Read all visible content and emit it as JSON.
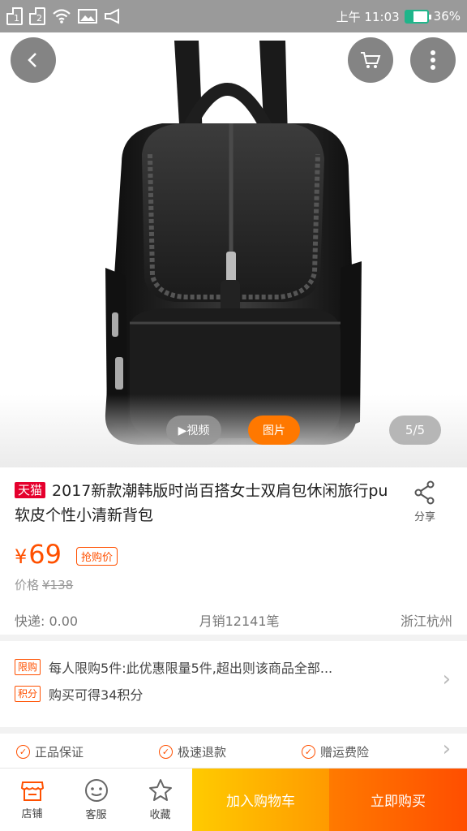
{
  "status_bar": {
    "sim1": "1",
    "sim2": "2",
    "time": "上午 11:03",
    "battery": "36%",
    "battery_level": 0.36
  },
  "gallery": {
    "video_label": "▶视频",
    "photo_label": "图片",
    "page_indicator": "5/5"
  },
  "product": {
    "store_tag": "天猫",
    "title": "2017新款潮韩版时尚百搭女士双肩包休闲旅行pu软皮个性小清新背包",
    "share_label": "分享",
    "price_currency": "¥",
    "price_value": "69",
    "price_tag": "抢购价",
    "original_label": "价格",
    "original_price": "¥138",
    "shipping": "快递: 0.00",
    "monthly_sales": "月销12141笔",
    "location": "浙江杭州"
  },
  "promotions": [
    {
      "tag": "限购",
      "text": "每人限购5件:此优惠限量5件,超出则该商品全部..."
    },
    {
      "tag": "积分",
      "text": "购买可得34积分"
    }
  ],
  "guarantees": [
    "正品保证",
    "极速退款",
    "赠运费险"
  ],
  "bottom_bar": {
    "store_label": "店铺",
    "service_label": "客服",
    "favorite_label": "收藏",
    "add_cart_label": "加入购物车",
    "buy_now_label": "立即购买"
  },
  "colors": {
    "accent": "#ff5000",
    "tmall_red": "#e5002d",
    "cart_button": "#ffb400",
    "buy_button": "#ff5a00"
  }
}
